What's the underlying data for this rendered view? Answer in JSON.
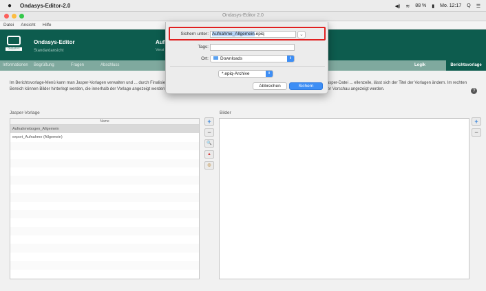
{
  "menubar": {
    "apple": "",
    "app_name": "Ondasys-Editor-2.0",
    "battery": "88 %",
    "clock": "Mo. 12:17",
    "search_glyph": "Q",
    "menu_glyph": "☰"
  },
  "window": {
    "title": "Ondasys-Editor 2.0"
  },
  "app_menu": [
    "Datei",
    "Ansicht",
    "Hilfe"
  ],
  "header": {
    "app_title": "Ondasys-Editor",
    "view": "Standardansicht",
    "doc_title": "Auf",
    "doc_version": "Versi",
    "logo_sub": "ONDASYS"
  },
  "tabs": {
    "informationen": "Informationen",
    "begruessung": "Begrüßung",
    "fragen": "Fragen",
    "abschluss": "Abschluss",
    "logik": "Logik",
    "berichtsvorlage": "Berichtsvorlage"
  },
  "description": "Im Berichtsvorlage-Menü kann man Jasper-Vorlagen verwalten und ... durch Finalisierung oder Import einer externen Jasper-Vorlage hinzufügen. Pro Vorlage kann nur eine Jasper-Datei ... ellenzeile, lässt sich der Titel der Vorlagen ändern. Im rechten Bereich können Bilder hinterlegt werden, die innerhalb der Vorlage angezeigt werden sollen. In der erweiterten Ansicht können eigene Werte für Platzhalter definiert und in einer Vorschau angezeigt werden.",
  "section_left": "Jasper-Vorlage",
  "section_right": "Bilder",
  "table": {
    "header": "Name",
    "rows": [
      "Aufnahmebogen_Allgemein",
      "export_Aufnahme (Allgemein)"
    ]
  },
  "side_buttons": {
    "add": "+",
    "remove": "−",
    "search": "🔍",
    "pdf": "▲",
    "preview": "◎"
  },
  "dialog": {
    "save_as_label": "Sichern unter:",
    "filename_base": "Aufnahme_Allgemein",
    "filename_ext": ".epiq",
    "tags_label": "Tags:",
    "location_label": "Ort:",
    "location_value": "Downloads",
    "format_value": "*.epiq-Archive",
    "cancel": "Abbrechen",
    "save": "Sichern"
  },
  "colors": {
    "header_green": "#0d5c4e",
    "tab_bar": "#7fa99e",
    "highlight_red": "#e02020",
    "accent_blue": "#3d8ef5"
  }
}
